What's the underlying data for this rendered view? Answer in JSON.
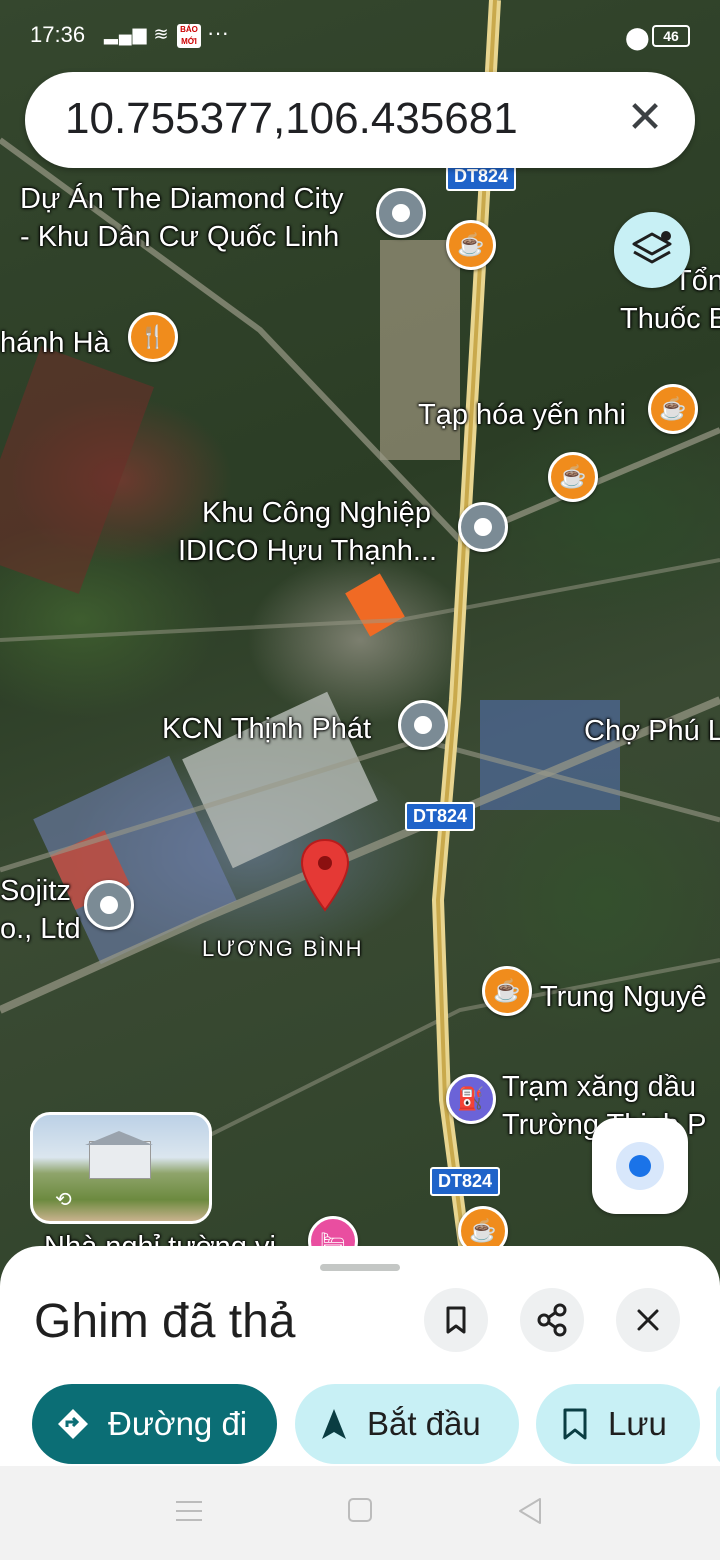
{
  "status_bar": {
    "time": "17:36",
    "signal": "4G",
    "dots": "···",
    "battery": "46",
    "news_icon_text": "BÁO MỚI"
  },
  "search": {
    "query": "10.755377,106.435681",
    "close_icon": "close-icon"
  },
  "map": {
    "labels": {
      "diamond_city_1": "Dự Án The Diamond City",
      "diamond_city_2": "- Khu Dân Cư Quốc Linh",
      "thanh_ha": "hánh Hà",
      "tong_1": "Tổn",
      "tong_2": "Thuốc B",
      "tap_hoa": "Tạp hóa yến nhi",
      "kcn_idico_1": "Khu Công Nghiệp",
      "kcn_idico_2": "IDICO Hựu Thạnh...",
      "kcn_thinh_phat": "KCN Thịnh Phát",
      "cho_phu": "Chợ Phú L",
      "sojitz_1": "Sojitz",
      "sojitz_2": "o., Ltd",
      "luong_binh": "LƯƠNG BÌNH",
      "trung_nguyen": "Trung Nguyê",
      "tram_xang_1": "Trạm xăng dầu",
      "tram_xang_2": "Trường Thịnh P",
      "nha_nghi": "Nhà nghỉ tường vi"
    },
    "road_shields": [
      "DT824",
      "DT824",
      "DT824"
    ]
  },
  "sheet": {
    "title": "Ghim đã thả",
    "chips": {
      "directions": "Đường đi",
      "start": "Bắt đầu",
      "save": "Lưu"
    }
  },
  "colors": {
    "primary_teal": "#0b6e75",
    "chip_light": "#c8f0f5",
    "pin_red": "#e53935",
    "blue_dot": "#1a73e8"
  }
}
